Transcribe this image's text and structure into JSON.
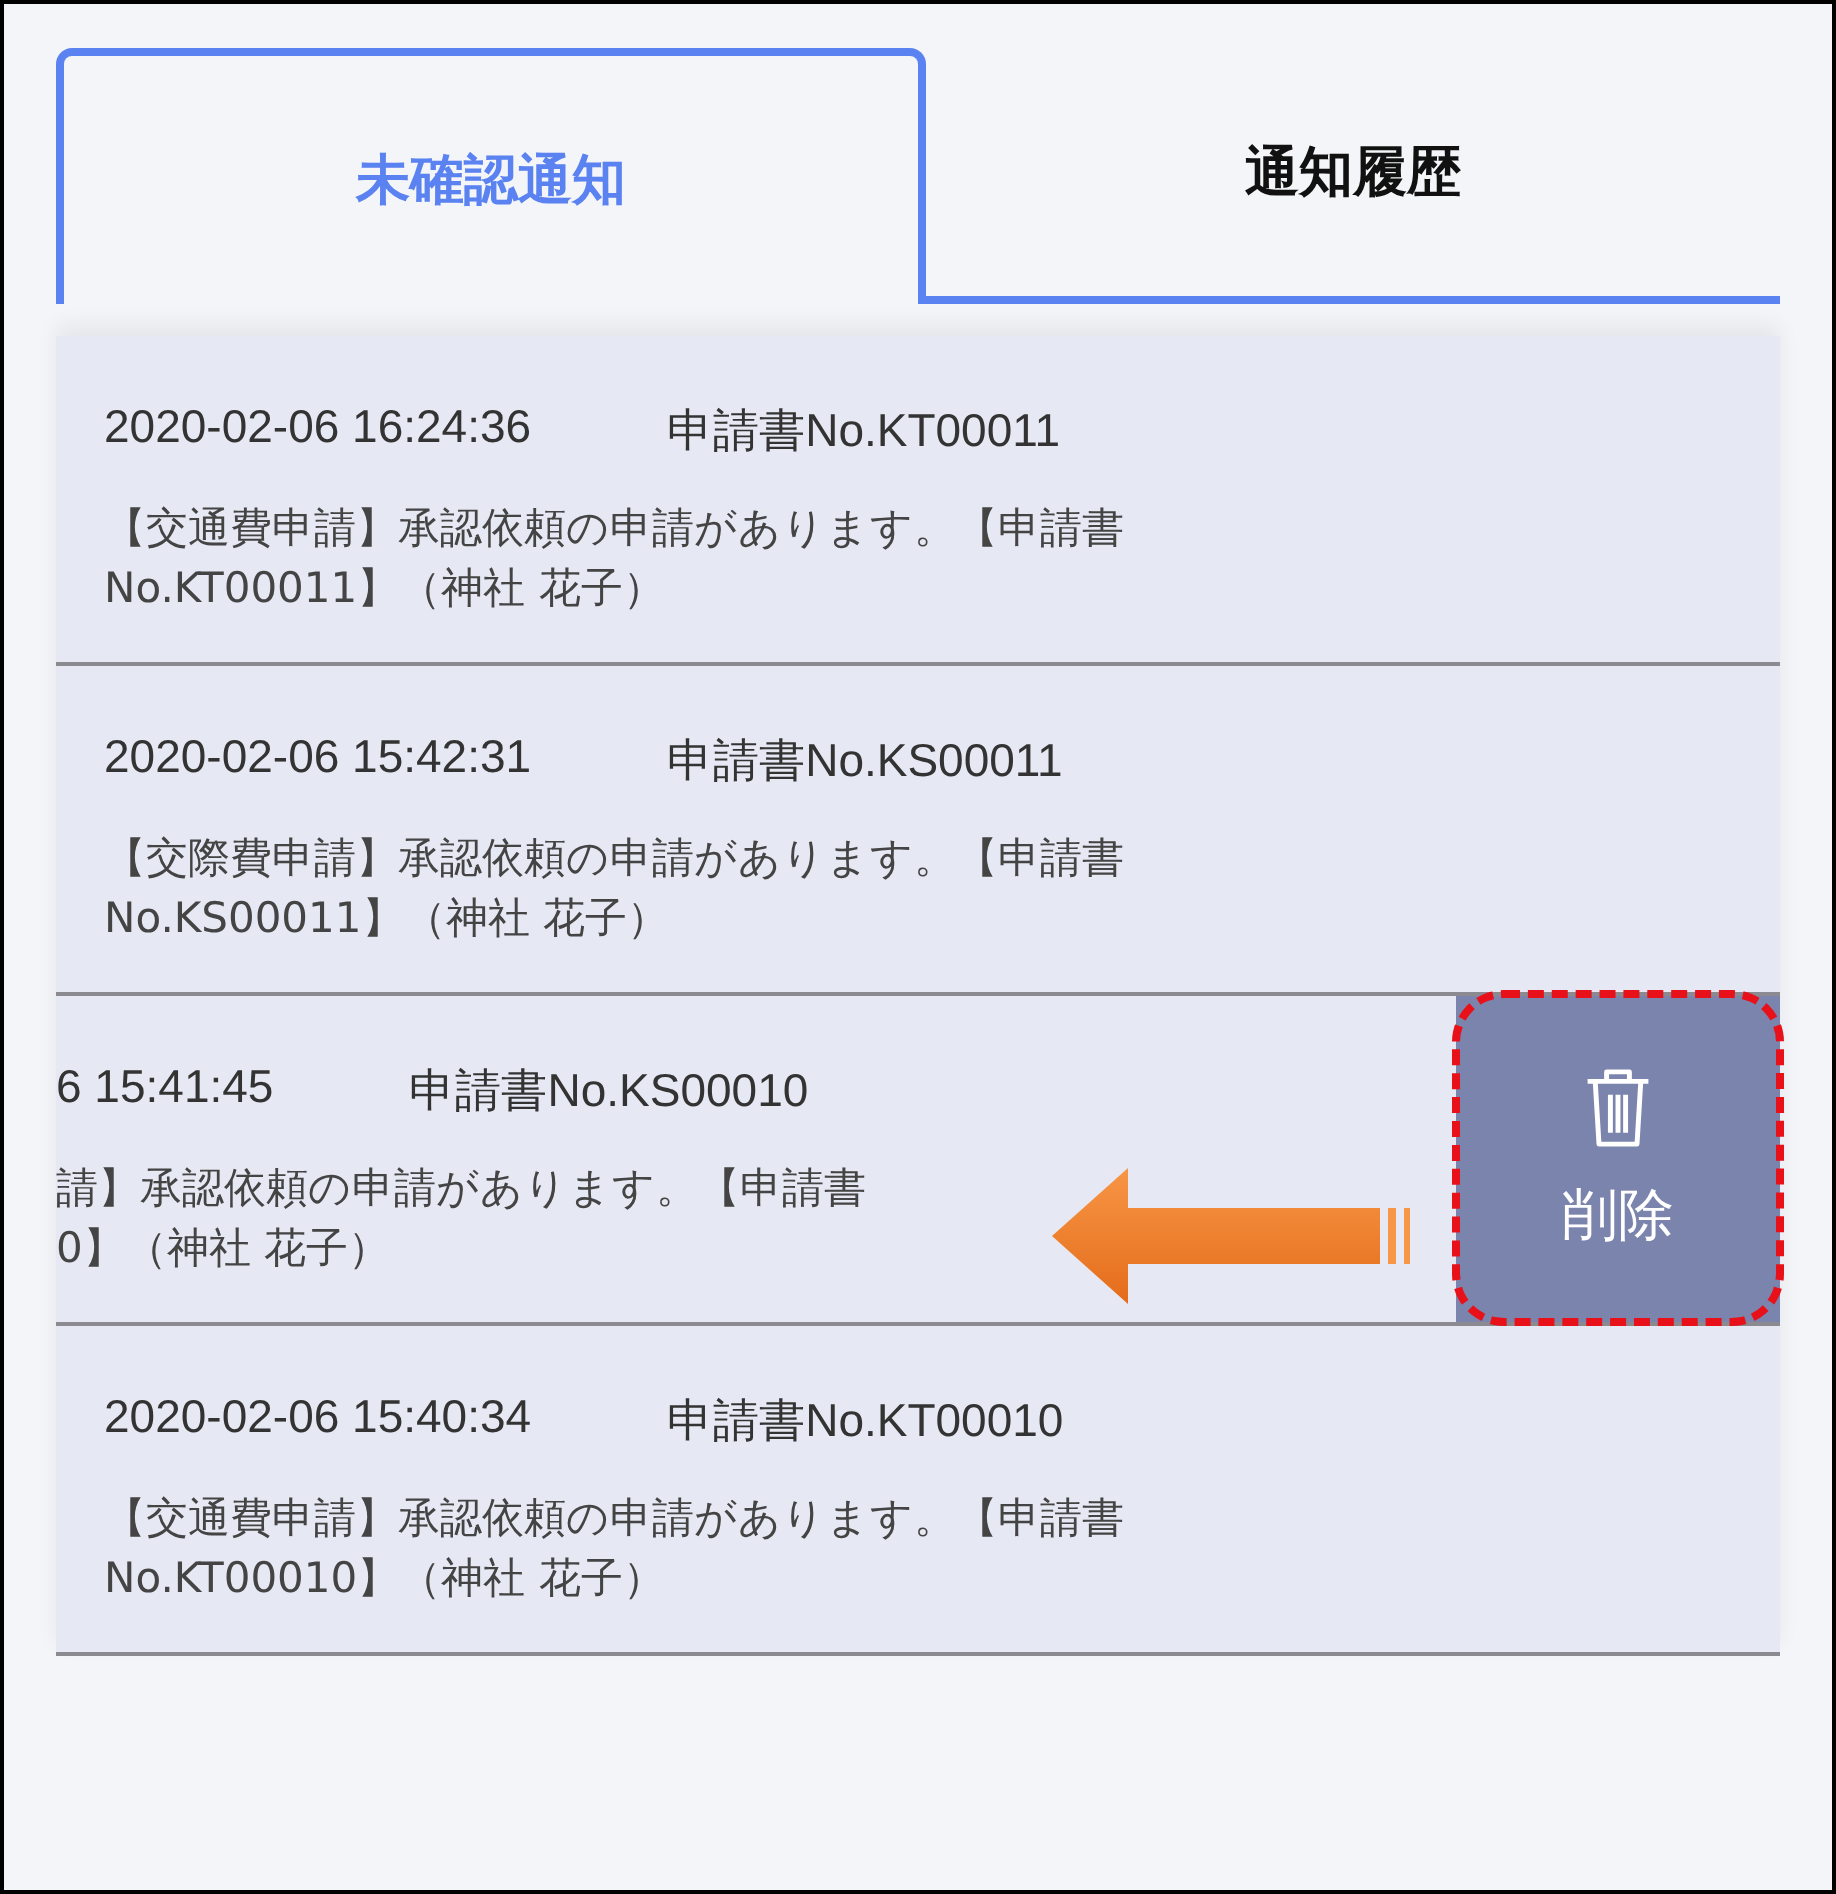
{
  "tabs": [
    {
      "label": "未確認通知",
      "selected": true
    },
    {
      "label": "通知履歴",
      "selected": false
    }
  ],
  "notifications": [
    {
      "time": "2020-02-06 16:24:36",
      "number": "申請書No.KT00011",
      "message_lines": [
        "【交通費申請】承認依頼の申請があります。【申請書",
        "No.KT00011】（神社 花子）"
      ],
      "swiped": false
    },
    {
      "time": "2020-02-06 15:42:31",
      "number": "申請書No.KS00011",
      "message_lines": [
        "【交際費申請】承認依頼の申請があります。【申請書",
        "No.KS00011】（神社 花子）"
      ],
      "swiped": false
    },
    {
      "time": "6 15:41:45",
      "number": "申請書No.KS00010",
      "message_lines": [
        "請】承認依頼の申請があります。【申請書",
        "0】（神社 花子）"
      ],
      "swiped": true,
      "delete_label": "削除"
    },
    {
      "time": "2020-02-06 15:40:34",
      "number": "申請書No.KT00010",
      "message_lines": [
        "【交通費申請】承認依頼の申請があります。【申請書",
        "No.KT00010】（神社 花子）"
      ],
      "swiped": false
    }
  ]
}
